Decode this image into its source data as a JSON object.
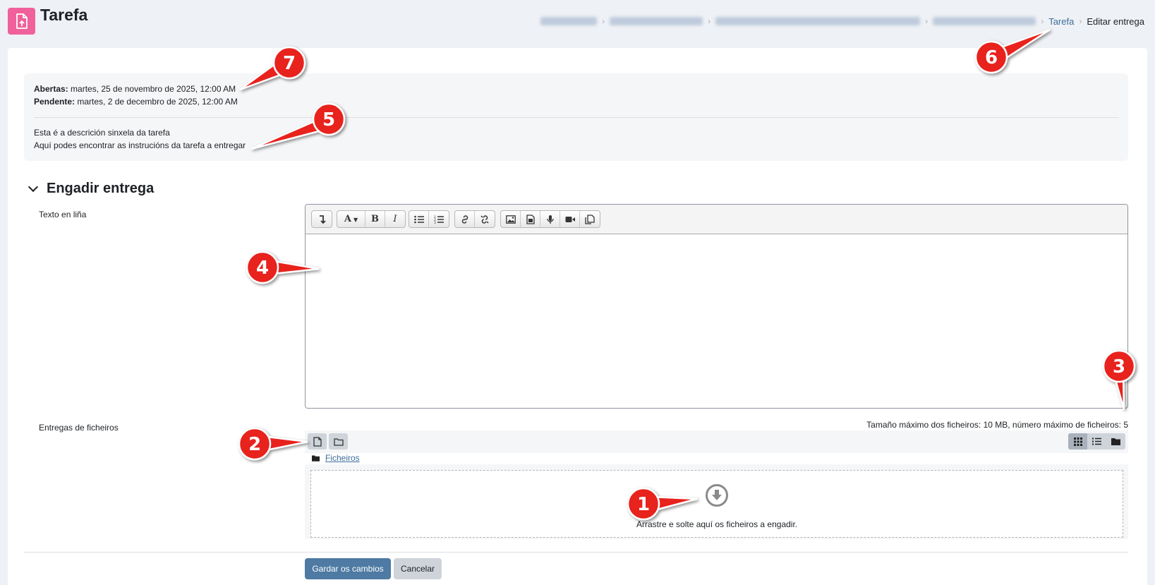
{
  "header": {
    "title": "Tarefa",
    "breadcrumb": {
      "link": "Tarefa",
      "current": "Editar entrega"
    }
  },
  "dates": {
    "opened_label": "Abertas:",
    "opened_value": "martes, 25 de novembro de 2025, 12:00 AM",
    "due_label": "Pendente:",
    "due_value": "martes, 2 de decembro de 2025, 12:00 AM"
  },
  "description": {
    "line1": "Esta é a descrición sinxela da tarefa",
    "line2": "Aquí podes encontrar as instrucións da tarefa a entregar"
  },
  "section": {
    "title": "Engadir entrega"
  },
  "online_text": {
    "label": "Texto en liña"
  },
  "file_submissions": {
    "label": "Entregas de ficheiros",
    "limits": "Tamaño máximo dos ficheiros: 10 MB, número máximo de ficheiros: 5",
    "path_label": "Ficheiros",
    "drop_text": "Arrastre e solte aquí os ficheiros a engadir."
  },
  "buttons": {
    "save": "Gardar os cambios",
    "cancel": "Cancelar"
  },
  "annotations": [
    "1",
    "2",
    "3",
    "4",
    "5",
    "6",
    "7"
  ],
  "colors": {
    "module_icon": "#f0609a",
    "primary_button": "#4e7aa3",
    "link": "#3c6d9b",
    "annotation": "#e8201c"
  }
}
